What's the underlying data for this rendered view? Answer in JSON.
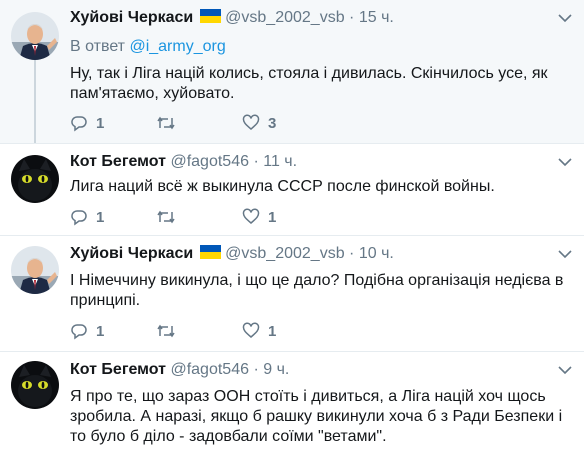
{
  "tweets": [
    {
      "name": "Хуйові Черкаси",
      "handle": "@vsb_2002_vsb",
      "time": "15 ч.",
      "reply_prefix": "В ответ ",
      "reply_to": "@i_army_org",
      "text": "Ну, так і Ліга націй колись, стояла і дивилась. Скінчилось усе, як пам'ятаємо, хуйовато.",
      "replies": "1",
      "retweets": "",
      "likes": "3"
    },
    {
      "name": "Кот Бегемот",
      "handle": "@fagot546",
      "time": "11 ч.",
      "text": "Лига наций всё ж выкинула СССР после финской войны.",
      "replies": "1",
      "retweets": "",
      "likes": "1"
    },
    {
      "name": "Хуйові Черкаси",
      "handle": "@vsb_2002_vsb",
      "time": "10 ч.",
      "text": "І Німеччину викинула, і що це дало? Подібна організація недієва в принципі.",
      "replies": "1",
      "retweets": "",
      "likes": "1"
    },
    {
      "name": "Кот Бегемот",
      "handle": "@fagot546",
      "time": "9 ч.",
      "text": "Я про те, що зараз ООН стоїть і дивиться, а Ліга націй хоч щось зробила. А наразі, якщо б рашку викинули хоча б  з Ради Безпеки і то  було б діло - задовбали соїми \"ветами\"."
    }
  ],
  "separator": "·",
  "caret": "⌄",
  "colors": {
    "link": "#1b95e0",
    "muted": "#657786",
    "flag_blue": "#0057b8",
    "flag_yellow": "#ffd700"
  },
  "icons": {
    "reply": "reply-icon",
    "retweet": "retweet-icon",
    "like": "heart-icon"
  }
}
